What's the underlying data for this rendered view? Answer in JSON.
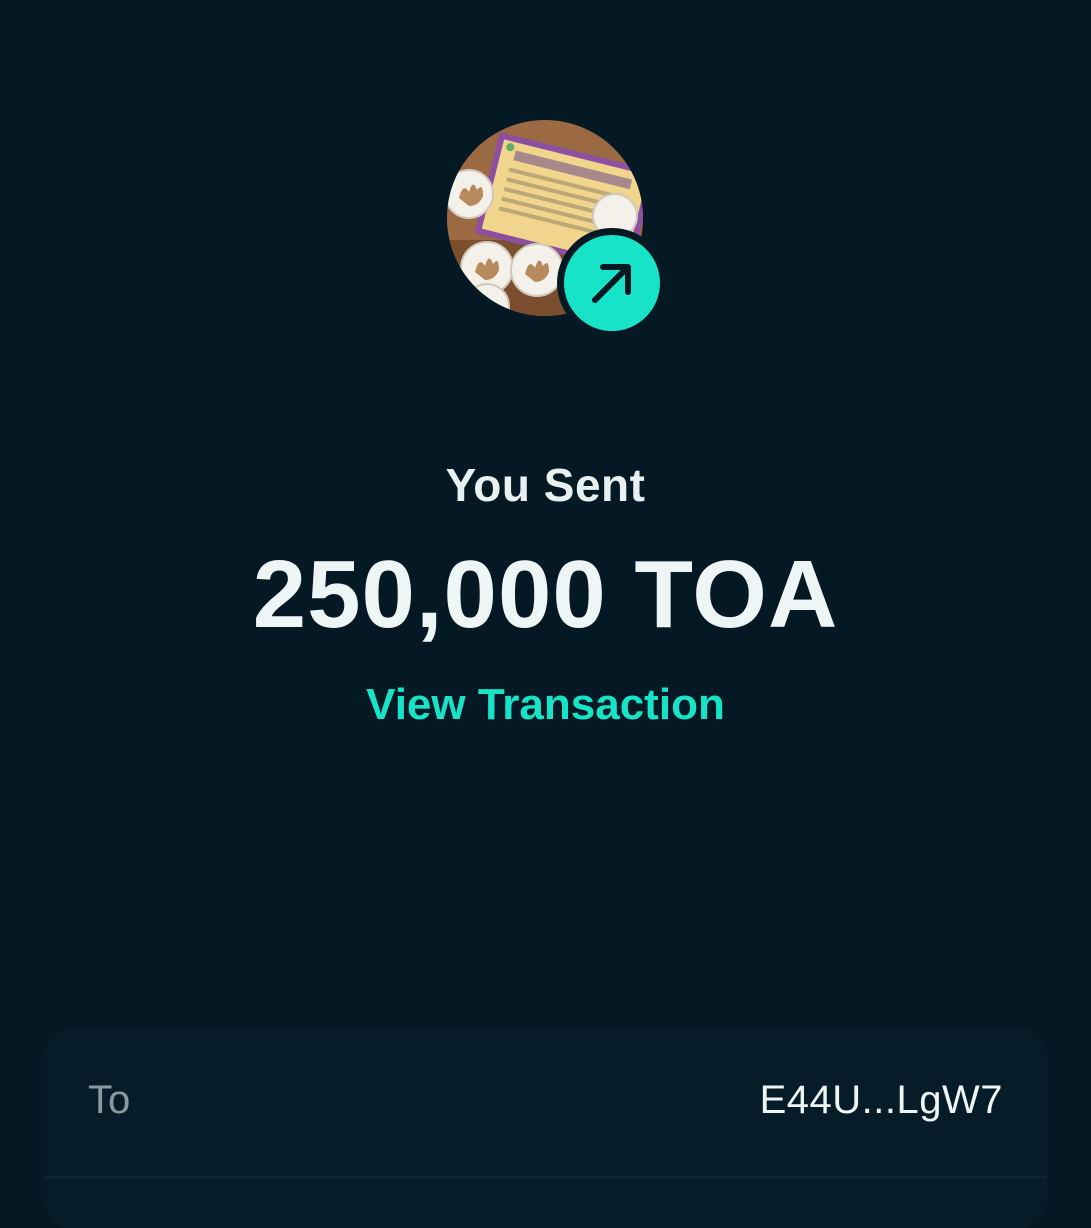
{
  "colors": {
    "background": "#041923",
    "accent": "#17e3c8",
    "card": "#061d29",
    "label": "#8a9aa1",
    "text": "#eef5f5"
  },
  "header": {
    "token_image": "token-of-appreciation-image",
    "badge_icon": "arrow-up-right-icon"
  },
  "transfer": {
    "title": "You Sent",
    "amount": "250,000 TOA",
    "view_transaction_label": "View Transaction"
  },
  "details": {
    "rows": [
      {
        "label": "To",
        "value": "E44U...LgW7"
      }
    ]
  }
}
